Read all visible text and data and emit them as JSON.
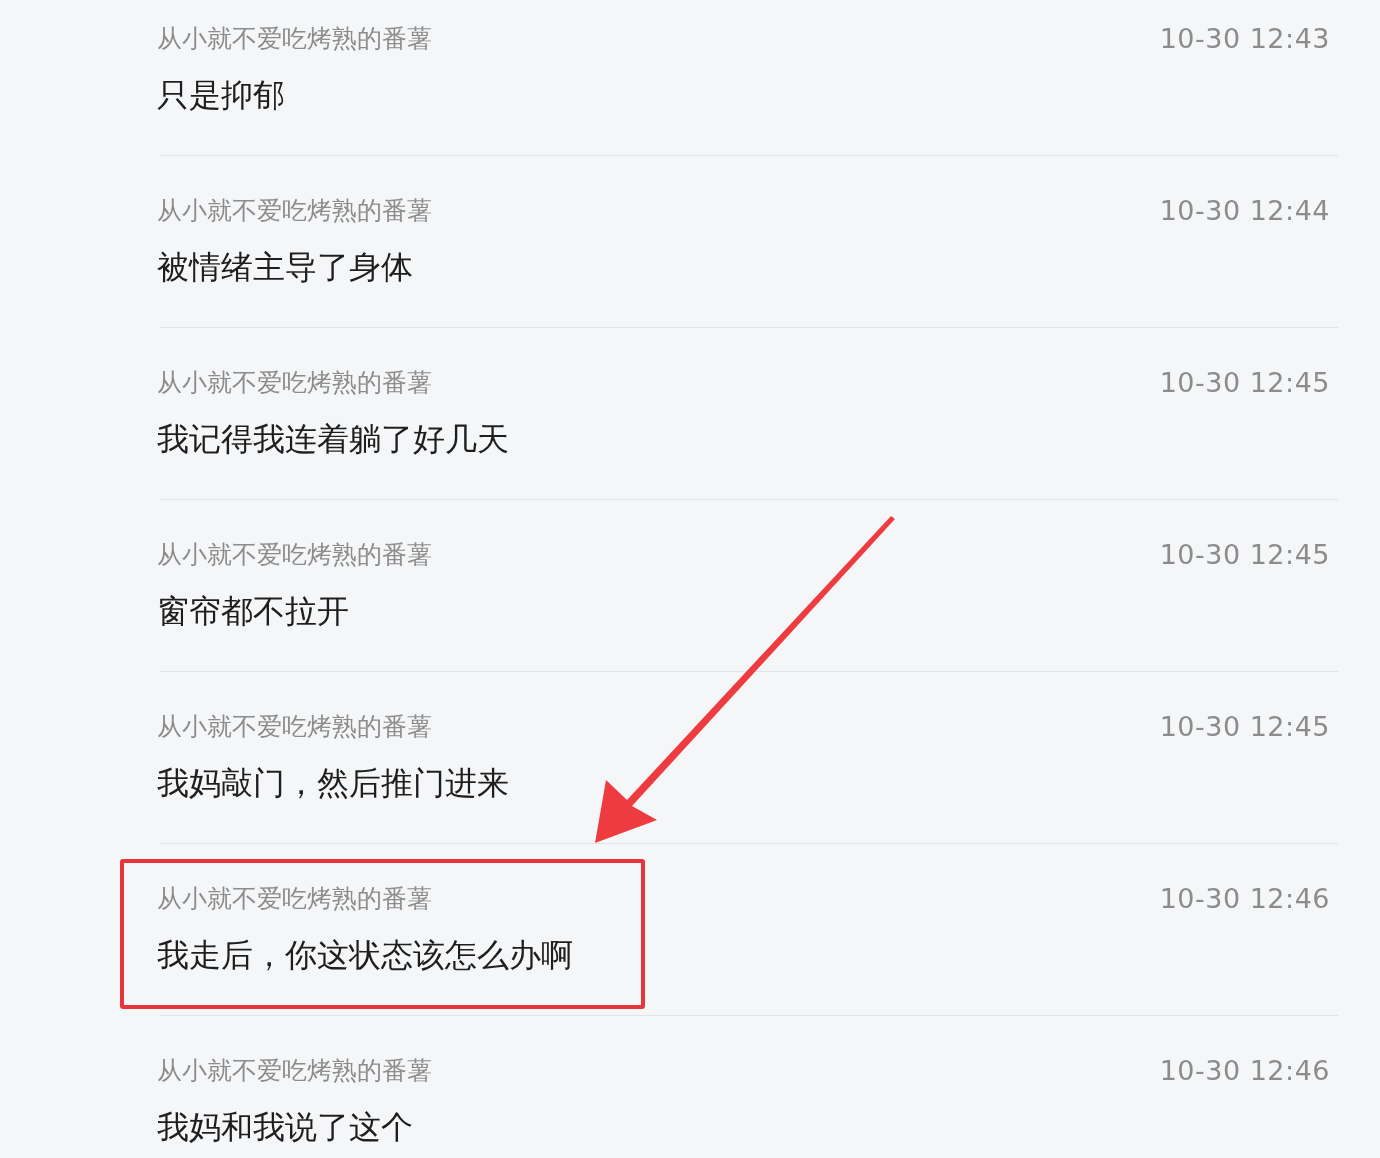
{
  "messages": [
    {
      "sender": "从小就不爱吃烤熟的番薯",
      "time": "10-30 12:43",
      "text": "只是抑郁",
      "highlighted": false
    },
    {
      "sender": "从小就不爱吃烤熟的番薯",
      "time": "10-30 12:44",
      "text": "被情绪主导了身体",
      "highlighted": false
    },
    {
      "sender": "从小就不爱吃烤熟的番薯",
      "time": "10-30 12:45",
      "text": "我记得我连着躺了好几天",
      "highlighted": false
    },
    {
      "sender": "从小就不爱吃烤熟的番薯",
      "time": "10-30 12:45",
      "text": "窗帘都不拉开",
      "highlighted": false
    },
    {
      "sender": "从小就不爱吃烤熟的番薯",
      "time": "10-30 12:45",
      "text": "我妈敲门，然后推门进来",
      "highlighted": false
    },
    {
      "sender": "从小就不爱吃烤熟的番薯",
      "time": "10-30 12:46",
      "text": "我走后，你这状态该怎么办啊",
      "highlighted": true
    },
    {
      "sender": "从小就不爱吃烤熟的番薯",
      "time": "10-30 12:46",
      "text": "我妈和我说了这个",
      "highlighted": false
    }
  ]
}
